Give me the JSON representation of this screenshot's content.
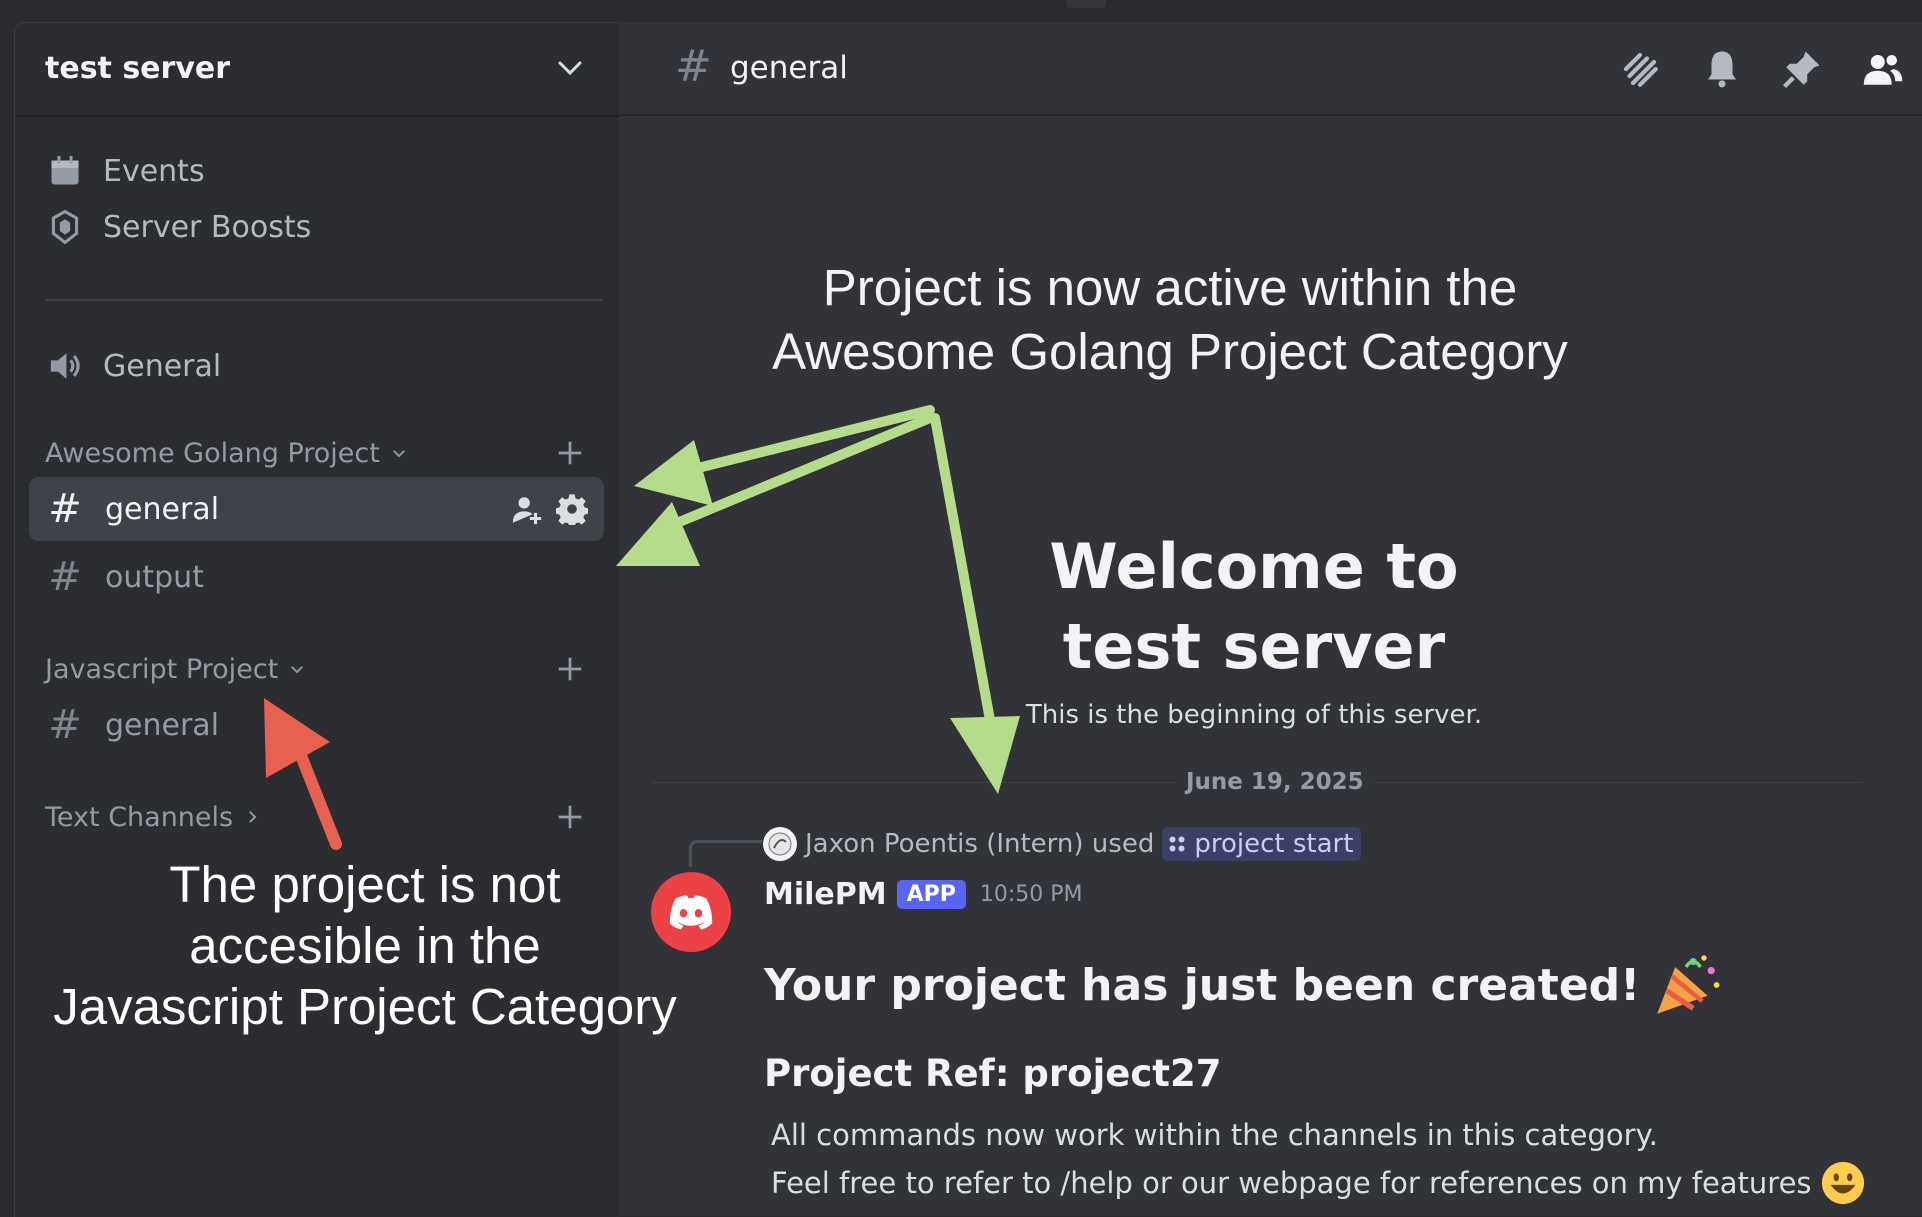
{
  "server": {
    "name": "test server"
  },
  "sidebar": {
    "top_items": [
      {
        "label": "Events",
        "icon": "calendar-icon"
      },
      {
        "label": "Server Boosts",
        "icon": "boost-shield-icon"
      }
    ],
    "voice_channel": {
      "label": "General",
      "icon": "speaker-icon"
    },
    "categories": [
      {
        "name": "Awesome Golang Project",
        "channels": [
          "general",
          "output"
        ],
        "expanded": true
      },
      {
        "name": "Javascript Project",
        "channels": [
          "general"
        ],
        "expanded": true
      },
      {
        "name": "Text Channels",
        "channels": [],
        "expanded": false
      }
    ]
  },
  "header": {
    "channel": "general"
  },
  "welcome": {
    "line1": "Welcome to",
    "line2": "test server",
    "subtitle": "This is the beginning of this server."
  },
  "date_divider": "June 19, 2025",
  "message": {
    "reply": {
      "user": "Jaxon Poentis (Intern) used",
      "command": "project start"
    },
    "author": "MilePM",
    "badge": "APP",
    "time": "10:50 PM",
    "title": "Your project has just been created!",
    "ref": "Project Ref: project27",
    "line1": "All commands now work within the channels in this category.",
    "line2": "Feel free to refer to /help or our webpage for references on my features"
  },
  "annotations": {
    "green_line1": "Project is now active within the",
    "green_line2": "Awesome Golang Project Category",
    "red_line1": "The project is not",
    "red_line2": "accesible in the",
    "red_line3": "Javascript Project Category"
  },
  "colors": {
    "green_arrow": "#b5dc8a",
    "red_arrow": "#e8604f",
    "brand": "#5865f2",
    "bot_avatar": "#ed4245"
  }
}
